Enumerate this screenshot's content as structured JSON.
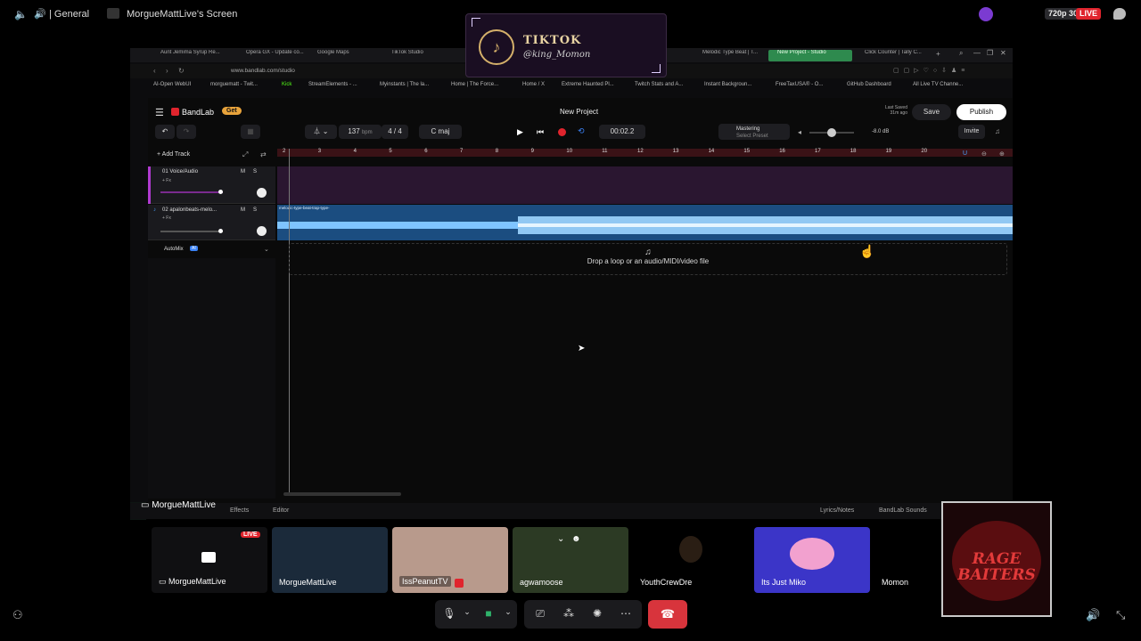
{
  "topbar": {
    "channel": "General",
    "screen_title": "MorgueMattLive's Screen",
    "quality": "720p 30FPS",
    "live_badge": "LIVE"
  },
  "overlay": {
    "brand": "TIKTOK",
    "handle": "@king_Momon"
  },
  "browser": {
    "tabs": [
      "Aunt Jemima Syrup Re...",
      "Opera GX - Update co...",
      "Google Maps",
      "TikTok Studio",
      "Melodic Type Beat | T...",
      "New Project - Studio",
      "Click Counter | Tally C..."
    ],
    "url": "www.bandlab.com/studio",
    "bookmarks": [
      "AI-Open WebUI",
      "morguematt - Twit...",
      "Kick",
      "StreamElements - ...",
      "Myinstants | The la...",
      "Home | The Force...",
      "Home / X",
      "Extreme Haunted Pl...",
      "Twitch Stats and A...",
      "Instant Backgroun...",
      "FreeTaxUSA® - O...",
      "GitHub Dashboard",
      "All Live TV Channe..."
    ]
  },
  "bandlab": {
    "logo": "BandLab",
    "get_label": "Get",
    "project_title": "New Project",
    "last_saved_line1": "Last Saved",
    "last_saved_line2": "31m ago",
    "save_label": "Save",
    "publish_label": "Publish",
    "bpm_value": "137",
    "bpm_unit": "bpm",
    "time_sig": "4 / 4",
    "key": "C maj",
    "time": "00:02.2",
    "mastering_title": "Mastering",
    "mastering_sub": "Select Preset",
    "volume_db": "-8.0 dB",
    "invite_label": "Invite",
    "add_track": "Add Track",
    "tracks": [
      {
        "name": "01 Voice/Audio",
        "fx": "+ Fx",
        "m": "M",
        "s": "S"
      },
      {
        "name": "02 apalonbeats-melo...",
        "fx": "+ Fx",
        "m": "M",
        "s": "S"
      }
    ],
    "region_label": "melodic-type-beat-trap-type-",
    "automix": "AutoMix",
    "automix_badge": "AI",
    "drop_text": "Drop a loop or an audio/MIDI/video file",
    "ruler": [
      "2",
      "3",
      "4",
      "5",
      "6",
      "7",
      "8",
      "9",
      "10",
      "11",
      "12",
      "13",
      "14",
      "15",
      "16",
      "17",
      "18",
      "19",
      "20"
    ],
    "bottom_tabs": [
      "Effects",
      "Editor"
    ],
    "bottom_right": [
      "Lyrics/Notes",
      "BandLab Sounds"
    ]
  },
  "call": {
    "presenter": "MorgueMattLive",
    "tiles": [
      {
        "name": "MorgueMattLive",
        "live": "LIVE"
      },
      {
        "name": "MorgueMattLive"
      },
      {
        "name": "IssPeanutTV"
      },
      {
        "name": "agwamoose"
      },
      {
        "name": "YouthCrewDre"
      },
      {
        "name": "Its Just Miko"
      },
      {
        "name": "Momon"
      }
    ],
    "rage_logo_text": "RAGE BAITERS"
  },
  "colors": {
    "live": "#e0242d",
    "record": "#e0242d",
    "waveform": "#1b4d80",
    "voice_lane": "#2a1630",
    "ruler": "#3a1216",
    "get_badge": "#e8a33b",
    "miko_tile": "#3b35c8"
  }
}
